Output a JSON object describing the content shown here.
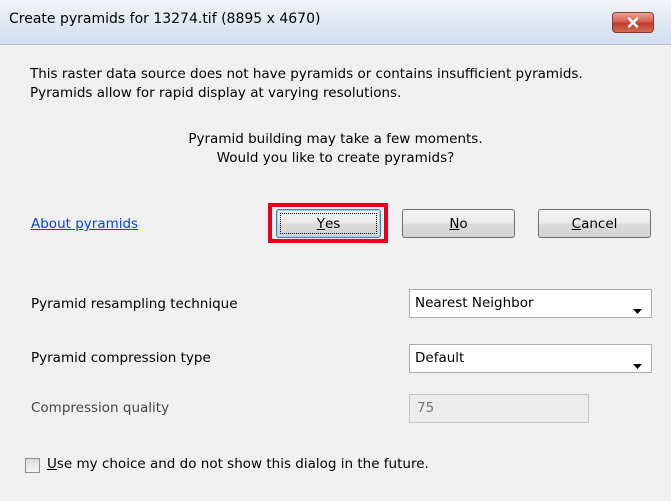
{
  "window": {
    "title": "Create pyramids for 13274.tif (8895 x 4670)"
  },
  "message": {
    "line1": "This raster data source does not have pyramids or contains insufficient pyramids.",
    "line2": "Pyramids allow for rapid display at varying resolutions.",
    "center_line1": "Pyramid building may take a few moments.",
    "center_line2": "Would you like to create pyramids?"
  },
  "links": {
    "about": "About pyramids"
  },
  "buttons": {
    "yes_mnemonic": "Y",
    "yes_rest": "es",
    "no_mnemonic": "N",
    "no_rest": "o",
    "cancel_mnemonic": "C",
    "cancel_rest": "ancel"
  },
  "options": {
    "resampling_label": "Pyramid resampling technique",
    "resampling_value": "Nearest Neighbor",
    "compression_label": "Pyramid compression type",
    "compression_value": "Default",
    "quality_label": "Compression quality",
    "quality_value": "75"
  },
  "footer": {
    "checkbox_mnemonic": "U",
    "checkbox_rest": "se my choice and do not show this dialog in the future.",
    "checked": false
  },
  "colors": {
    "highlight": "#e4001b",
    "link": "#0b44c6",
    "close_button": "#c0392b"
  },
  "icons": {
    "close": "close-icon",
    "dropdown": "chevron-down-icon"
  }
}
